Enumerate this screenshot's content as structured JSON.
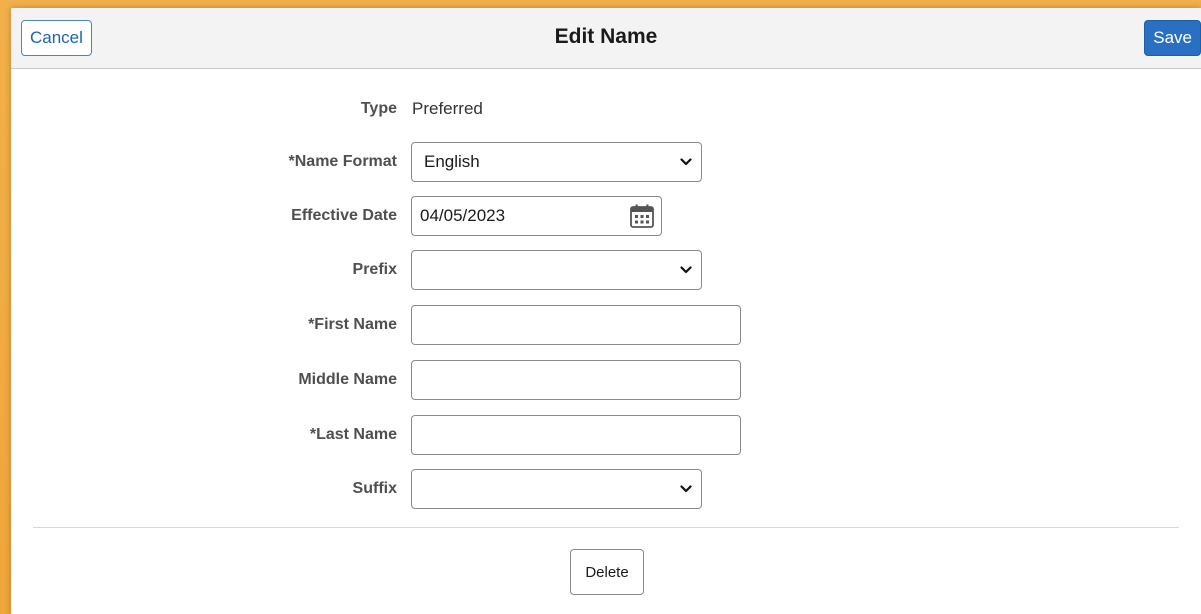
{
  "header": {
    "title": "Edit Name",
    "cancel_label": "Cancel",
    "save_label": "Save"
  },
  "form": {
    "type": {
      "label": "Type",
      "value": "Preferred"
    },
    "name_format": {
      "label": "*Name Format",
      "value": "English"
    },
    "effective_date": {
      "label": "Effective Date",
      "value": "04/05/2023"
    },
    "prefix": {
      "label": "Prefix",
      "value": ""
    },
    "first_name": {
      "label": "*First Name",
      "value": ""
    },
    "middle_name": {
      "label": "Middle Name",
      "value": ""
    },
    "last_name": {
      "label": "*Last Name",
      "value": ""
    },
    "suffix": {
      "label": "Suffix",
      "value": ""
    }
  },
  "footer": {
    "delete_label": "Delete"
  },
  "icons": {
    "dropdown": "chevron-down-icon",
    "date_picker": "calendar-icon"
  },
  "colors": {
    "backdrop": "#efa63a",
    "primary_button": "#2a70c2",
    "cancel_border": "#4a86c5"
  }
}
